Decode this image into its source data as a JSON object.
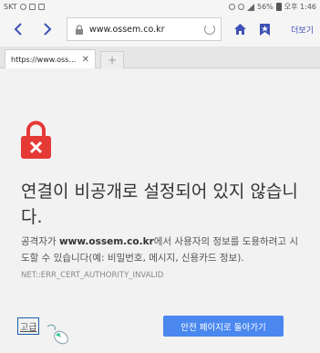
{
  "status_bar": {
    "carrier": "SKT",
    "battery": "56%",
    "time": "오후 1:46"
  },
  "toolbar": {
    "back_icon": "chevron-left-icon",
    "forward_icon": "chevron-right-icon",
    "url": "www.ossem.co.kr",
    "home_icon": "home-icon",
    "bookmark_icon": "bookmark-icon",
    "more_label": "더보기"
  },
  "tabs": [
    {
      "title": "https://www.oss…"
    }
  ],
  "newtab_label": "+",
  "error_page": {
    "icon": "broken-lock-icon",
    "heading": "연결이 비공개로 설정되어 있지 않습니다.",
    "explain_prefix": "공격자가 ",
    "explain_domain": "www.ossem.co.kr",
    "explain_suffix": "에서 사용자의 정보를 도용하려고 시도할 수 있습니다(예: 비밀번호, 메시지, 신용카드 정보).",
    "error_code": "NET::ERR_CERT_AUTHORITY_INVALID",
    "advanced_label": "고급",
    "back_to_safety_label": "안전 페이지로 돌아가기"
  },
  "colors": {
    "lock_red": "#e53935",
    "button_blue": "#4a88ef",
    "toolbar_accent": "#3f51b5"
  }
}
